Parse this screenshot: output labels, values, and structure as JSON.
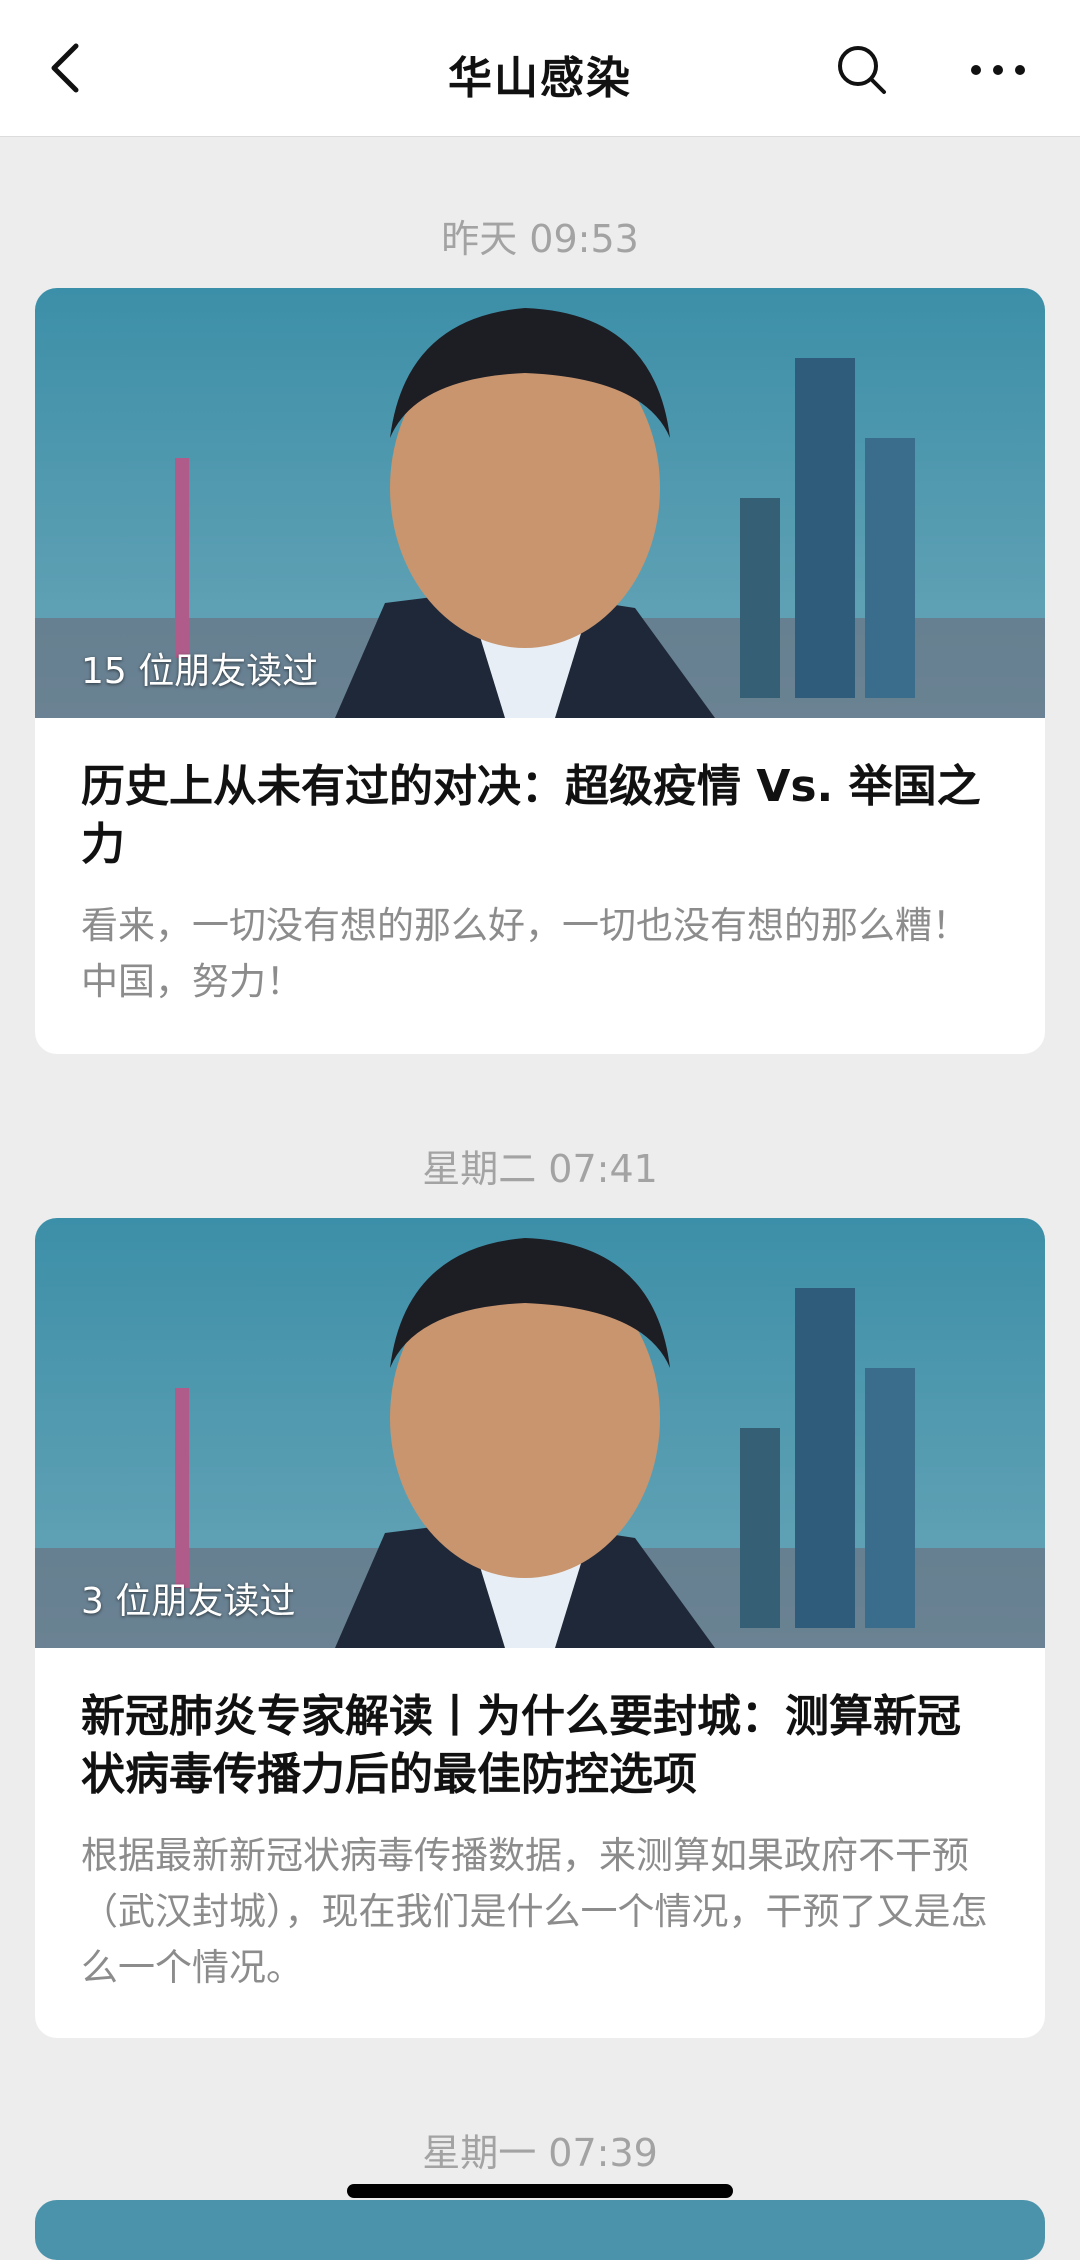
{
  "header": {
    "title": "华山感染",
    "back_icon": "chevron-left-icon",
    "search_icon": "search-icon",
    "more_icon": "more-horizontal-icon"
  },
  "feed": [
    {
      "timestamp": "昨天 09:53",
      "read_count": "15 位朋友读过",
      "title": "历史上从未有过的对决：超级疫情 Vs. 举国之力",
      "summary": "看来，一切没有想的那么好，一切也没有想的那么糟！中国，努力！"
    },
    {
      "timestamp": "星期二 07:41",
      "read_count": "3 位朋友读过",
      "title": "新冠肺炎专家解读丨为什么要封城：测算新冠状病毒传播力后的最佳防控选项",
      "summary": "根据最新新冠状病毒传播数据，来测算如果政府不干预（武汉封城），现在我们是什么一个情况，干预了又是怎么一个情况。"
    },
    {
      "timestamp": "星期一 07:39"
    }
  ]
}
